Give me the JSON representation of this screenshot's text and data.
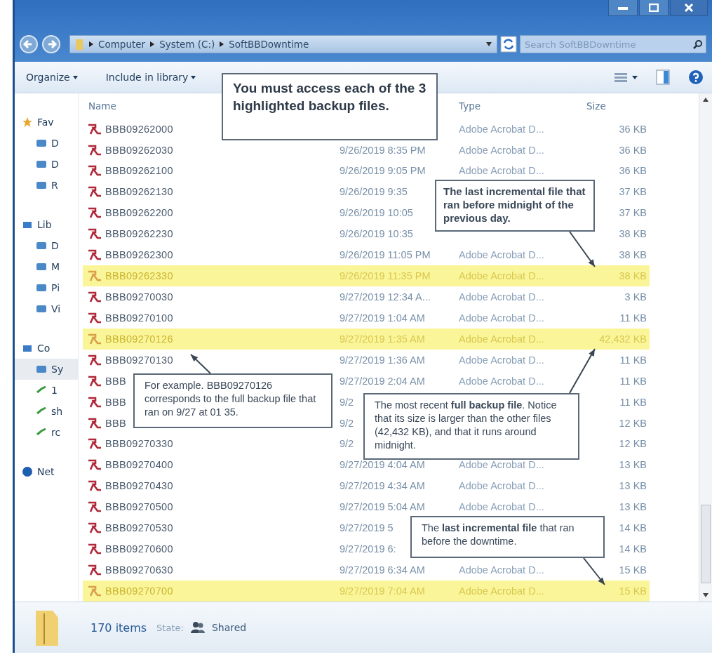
{
  "address_bar": {
    "crumbs": [
      "Computer",
      "System (C:)",
      "SoftBBDowntime"
    ],
    "search_placeholder": "Search SoftBBDowntime"
  },
  "toolbar": {
    "items": [
      "Organize",
      "Include in library"
    ]
  },
  "sidebar": {
    "items": [
      {
        "label": "Fav",
        "selected": false,
        "children": [
          {
            "label": "D",
            "selected": false
          },
          {
            "label": "D",
            "selected": false
          },
          {
            "label": "R",
            "selected": false
          }
        ]
      },
      {
        "label": "Lib",
        "selected": false,
        "children": [
          {
            "label": "D",
            "selected": false
          },
          {
            "label": "M",
            "selected": false
          },
          {
            "label": "Pi",
            "selected": false
          },
          {
            "label": "Vi",
            "selected": false
          }
        ]
      },
      {
        "label": "Co",
        "selected": false,
        "children": [
          {
            "label": "Sy",
            "selected": true
          },
          {
            "label": "1",
            "selected": false
          },
          {
            "label": "sh",
            "selected": false
          },
          {
            "label": "rc",
            "selected": false
          }
        ]
      },
      {
        "label": "Net",
        "selected": false
      }
    ]
  },
  "file_list": {
    "columns": [
      "Name",
      "Type",
      "Size"
    ],
    "rows": [
      {
        "name": "BBB09262000",
        "type": "Adobe Acrobat D...",
        "size": "36 KB",
        "highlighted": false
      },
      {
        "name": "BBB09262030",
        "date": "9/26/2019 8:35 PM",
        "type": "Adobe Acrobat D...",
        "size": "36 KB",
        "highlighted": false
      },
      {
        "name": "BBB09262100",
        "date": "9/26/2019 9:05 PM",
        "type": "Adobe Acrobat D...",
        "size": "36 KB",
        "highlighted": false
      },
      {
        "name": "BBB09262130",
        "date": "9/26/2019 9:35",
        "size": "37 KB",
        "highlighted": false
      },
      {
        "name": "BBB09262200",
        "date": "9/26/2019 10:05",
        "size": "37 KB",
        "highlighted": false
      },
      {
        "name": "BBB09262230",
        "date": "9/26/2019 10:35",
        "size": "38 KB",
        "highlighted": false
      },
      {
        "name": "BBB09262300",
        "date": "9/26/2019 11:05 PM",
        "type": "Adobe Acrobat D...",
        "size": "38 KB",
        "highlighted": false
      },
      {
        "name": "BBB09262330",
        "date": "9/26/2019 11:35 PM",
        "type": "Adobe Acrobat D...",
        "size": "38 KB",
        "highlighted": true
      },
      {
        "name": "BBB09270030",
        "date": "9/27/2019 12:34 A...",
        "type": "Adobe Acrobat D...",
        "size": "3 KB",
        "highlighted": false
      },
      {
        "name": "BBB09270100",
        "date": "9/27/2019 1:04 AM",
        "type": "Adobe Acrobat D...",
        "size": "11 KB",
        "highlighted": false
      },
      {
        "name": "BBB09270126",
        "date": "9/27/2019 1:35 AM",
        "type": "Adobe Acrobat D...",
        "size": "42,432 KB",
        "highlighted": true
      },
      {
        "name": "BBB09270130",
        "date": "9/27/2019 1:36 AM",
        "type": "Adobe Acrobat D...",
        "size": "11 KB",
        "highlighted": false
      },
      {
        "name": "BBB",
        "date": "9/27/2019 2:04 AM",
        "type": "Adobe Acrobat D...",
        "size": "11 KB",
        "highlighted": false
      },
      {
        "name": "BBB",
        "date": "9/2",
        "size": "11 KB",
        "highlighted": false
      },
      {
        "name": "BBB",
        "date": "9/2",
        "size": "12 KB",
        "highlighted": false
      },
      {
        "name": "BBB09270330",
        "date": "9/2",
        "size": "12 KB",
        "highlighted": false
      },
      {
        "name": "BBB09270400",
        "date": "9/27/2019 4:04 AM",
        "type": "Adobe Acrobat D...",
        "size": "13 KB",
        "highlighted": false
      },
      {
        "name": "BBB09270430",
        "date": "9/27/2019 4:34 AM",
        "type": "Adobe Acrobat D...",
        "size": "13 KB",
        "highlighted": false
      },
      {
        "name": "BBB09270500",
        "date": "9/27/2019 5:04 AM",
        "type": "Adobe Acrobat D...",
        "size": "13 KB",
        "highlighted": false
      },
      {
        "name": "BBB09270530",
        "date": "9/27/2019 5",
        "size": "14 KB",
        "highlighted": false
      },
      {
        "name": "BBB09270600",
        "date": "9/27/2019 6:",
        "size": "14 KB",
        "highlighted": false
      },
      {
        "name": "BBB09270630",
        "date": "9/27/2019 6:34 AM",
        "type": "Adobe Acrobat D...",
        "size": "15 KB",
        "highlighted": false
      },
      {
        "name": "BBB09270700",
        "date": "9/27/2019 7:04 AM",
        "type": "Adobe Acrobat D...",
        "size": "15 KB",
        "highlighted": true
      }
    ]
  },
  "status_bar": {
    "count": "170 items",
    "state_label": "State:",
    "state": "Shared"
  },
  "callouts": [
    {
      "kind": "heading",
      "text": "You must access each of the 3 highlighted backup files."
    },
    {
      "kind": "note",
      "text": "The **last incremental file** that ran before midnight of the previous day."
    },
    {
      "kind": "plain",
      "text": "For example. BBB09270126 corresponds to the full backup file that ran on 9/27 at 01 35."
    },
    {
      "kind": "plain",
      "text": "The most recent **full backup file**. Notice that its size is larger than the other files (42,432 KB), and that it runs around midnight."
    },
    {
      "kind": "plain",
      "text": "The **last incremental file** that ran before the downtime."
    }
  ]
}
